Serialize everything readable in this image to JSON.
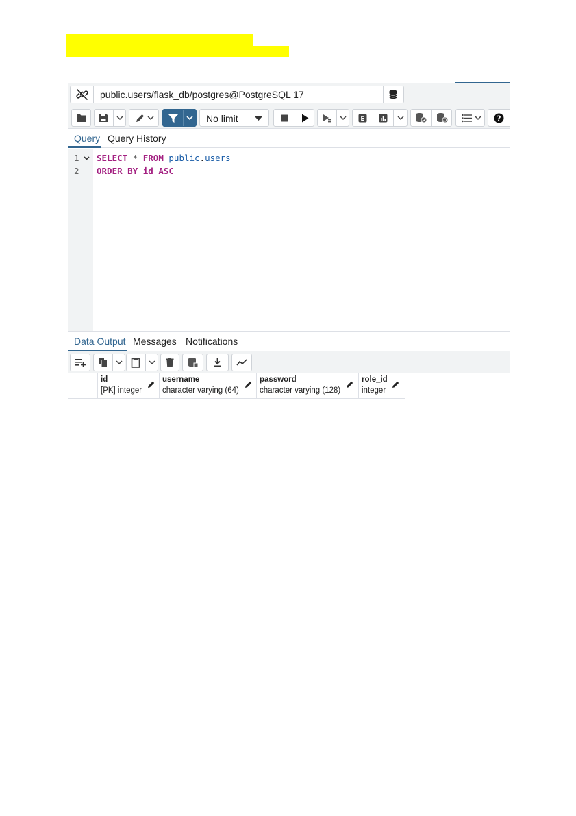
{
  "connection": {
    "label": "public.users/flask_db/postgres@PostgreSQL 17"
  },
  "toolbar": {
    "limit_value": "No limit",
    "buttons": [
      "folder-icon",
      "save-icon",
      "edit-icon",
      "filter-icon",
      "stop-icon",
      "execute-icon",
      "explain-icon",
      "explain-analyze-icon",
      "commit-icon",
      "rollback-icon",
      "macros-icon",
      "help-icon"
    ]
  },
  "query_tabs": [
    {
      "label": "Query",
      "active": true
    },
    {
      "label": "Query History",
      "active": false
    }
  ],
  "editor": {
    "lines": [
      {
        "num": "1",
        "kw1": "SELECT",
        "op": "*",
        "kw2": "FROM",
        "schema": "public",
        "table": "users"
      },
      {
        "num": "2",
        "kw1": "ORDER BY",
        "col": "id",
        "kw2": "ASC"
      }
    ]
  },
  "output_tabs": [
    {
      "label": "Data Output",
      "active": true
    },
    {
      "label": "Messages",
      "active": false
    },
    {
      "label": "Notifications",
      "active": false
    }
  ],
  "columns": [
    {
      "name": "id",
      "type": "[PK] integer"
    },
    {
      "name": "username",
      "type": "character varying (64)"
    },
    {
      "name": "password",
      "type": "character varying (128)"
    },
    {
      "name": "role_id",
      "type": "integer"
    }
  ],
  "colors": {
    "accent": "#326690",
    "keyword": "#a32081",
    "identifier": "#1a5da8",
    "highlight": "#ffff00"
  }
}
